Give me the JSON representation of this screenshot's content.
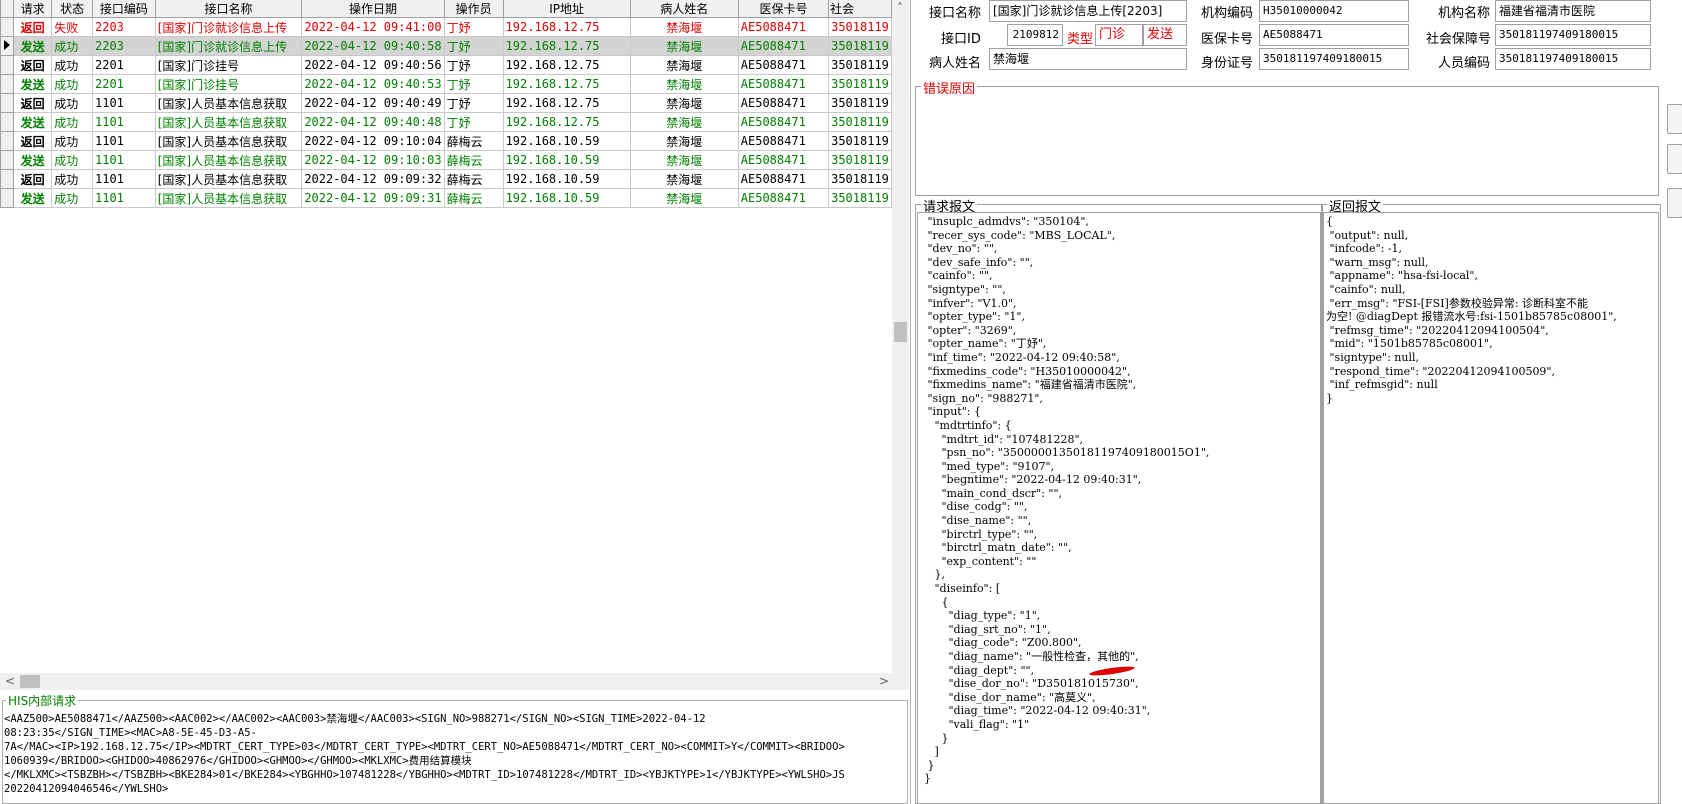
{
  "grid": {
    "headers": [
      "请求",
      "状态",
      "接口编码",
      "接口名称",
      "操作日期",
      "操作员",
      "IP地址",
      "病人姓名",
      "医保卡号",
      "社会"
    ],
    "rows": [
      {
        "kind": "返回",
        "status": "失败",
        "code": "2203",
        "name": "[国家]门诊就诊信息上传",
        "date": "2022-04-12 09:41:00",
        "operator": "丁妤",
        "ip": "192.168.12.75",
        "patient": "禁海堰",
        "card": "AE5088471",
        "social": "35018119",
        "color": "red",
        "selected": false
      },
      {
        "kind": "发送",
        "status": "成功",
        "code": "2203",
        "name": "[国家]门诊就诊信息上传",
        "date": "2022-04-12 09:40:58",
        "operator": "丁妤",
        "ip": "192.168.12.75",
        "patient": "禁海堰",
        "card": "AE5088471",
        "social": "35018119",
        "color": "green",
        "selected": true
      },
      {
        "kind": "返回",
        "status": "成功",
        "code": "2201",
        "name": "[国家]门诊挂号",
        "date": "2022-04-12 09:40:56",
        "operator": "丁妤",
        "ip": "192.168.12.75",
        "patient": "禁海堰",
        "card": "AE5088471",
        "social": "35018119",
        "color": "black",
        "selected": false
      },
      {
        "kind": "发送",
        "status": "成功",
        "code": "2201",
        "name": "[国家]门诊挂号",
        "date": "2022-04-12 09:40:53",
        "operator": "丁妤",
        "ip": "192.168.12.75",
        "patient": "禁海堰",
        "card": "AE5088471",
        "social": "35018119",
        "color": "green",
        "selected": false
      },
      {
        "kind": "返回",
        "status": "成功",
        "code": "1101",
        "name": "[国家]人员基本信息获取",
        "date": "2022-04-12 09:40:49",
        "operator": "丁妤",
        "ip": "192.168.12.75",
        "patient": "禁海堰",
        "card": "AE5088471",
        "social": "35018119",
        "color": "black",
        "selected": false
      },
      {
        "kind": "发送",
        "status": "成功",
        "code": "1101",
        "name": "[国家]人员基本信息获取",
        "date": "2022-04-12 09:40:48",
        "operator": "丁妤",
        "ip": "192.168.12.75",
        "patient": "禁海堰",
        "card": "AE5088471",
        "social": "35018119",
        "color": "green",
        "selected": false
      },
      {
        "kind": "返回",
        "status": "成功",
        "code": "1101",
        "name": "[国家]人员基本信息获取",
        "date": "2022-04-12 09:10:04",
        "operator": "薛梅云",
        "ip": "192.168.10.59",
        "patient": "禁海堰",
        "card": "AE5088471",
        "social": "35018119",
        "color": "black",
        "selected": false
      },
      {
        "kind": "发送",
        "status": "成功",
        "code": "1101",
        "name": "[国家]人员基本信息获取",
        "date": "2022-04-12 09:10:03",
        "operator": "薛梅云",
        "ip": "192.168.10.59",
        "patient": "禁海堰",
        "card": "AE5088471",
        "social": "35018119",
        "color": "green",
        "selected": false
      },
      {
        "kind": "返回",
        "status": "成功",
        "code": "1101",
        "name": "[国家]人员基本信息获取",
        "date": "2022-04-12 09:09:32",
        "operator": "薛梅云",
        "ip": "192.168.10.59",
        "patient": "禁海堰",
        "card": "AE5088471",
        "social": "35018119",
        "color": "black",
        "selected": false
      },
      {
        "kind": "发送",
        "status": "成功",
        "code": "1101",
        "name": "[国家]人员基本信息获取",
        "date": "2022-04-12 09:09:31",
        "operator": "薛梅云",
        "ip": "192.168.10.59",
        "patient": "禁海堰",
        "card": "AE5088471",
        "social": "35018119",
        "color": "green",
        "selected": false
      }
    ]
  },
  "scroll": {
    "up": "˄",
    "down": "˅",
    "left": "<",
    "right": ">"
  },
  "his": {
    "title": "HIS内部请求",
    "text": "<AAZ500>AE5088471</AAZ500><AAC002></AAC002><AAC003>禁海堰</AAC003><SIGN_NO>988271</SIGN_NO><SIGN_TIME>2022-04-12\n08:23:35</SIGN_TIME><MAC>A8-5E-45-D3-A5-\n7A</MAC><IP>192.168.12.75</IP><MDTRT_CERT_TYPE>03</MDTRT_CERT_TYPE><MDTRT_CERT_NO>AE5088471</MDTRT_CERT_NO><COMMIT>Y</COMMIT><BRIDOO>\n1060939</BRIDOO><GHIDOO>40862976</GHIDOO><GHMOO></GHMOO><MKLXMC>费用结算模块\n</MKLXMC><TSBZBH></TSBZBH><BKE284>01</BKE284><YBGHHO>107481228</YBGHHO><MDTRT_ID>107481228</MDTRT_ID><YBJKTYPE>1</YBJKTYPE><YWLSHO>JS\n20220412094046546</YWLSHO>"
  },
  "info": {
    "interface_name_label": "接口名称",
    "interface_name": "[国家]门诊就诊信息上传[2203]",
    "org_code_label": "机构编码",
    "org_code": "H35010000042",
    "org_name_label": "机构名称",
    "org_name": "福建省福清市医院",
    "interface_id_label": "接口ID",
    "interface_id": "2109812",
    "type_label": "类型",
    "type_value": "门诊",
    "direction_value": "发送",
    "card_label": "医保卡号",
    "card": "AE5088471",
    "social_label": "社会保障号",
    "social": "350181197409180015",
    "patient_label": "病人姓名",
    "patient": "禁海堰",
    "idcard_label": "身份证号",
    "idcard": "350181197409180015",
    "staff_label": "人员编码",
    "staff": "350181197409180015"
  },
  "error": {
    "title": "错误原因",
    "text": ""
  },
  "request": {
    "title": "请求报文",
    "text": " \"insuplc_admdvs\": \"350104\",\n \"recer_sys_code\": \"MBS_LOCAL\",\n \"dev_no\": \"\",\n \"dev_safe_info\": \"\",\n \"cainfo\": \"\",\n \"signtype\": \"\",\n \"infver\": \"V1.0\",\n \"opter_type\": \"1\",\n \"opter\": \"3269\",\n \"opter_name\": \"丁妤\",\n \"inf_time\": \"2022-04-12 09:40:58\",\n \"fixmedins_code\": \"H35010000042\",\n \"fixmedins_name\": \"福建省福清市医院\",\n \"sign_no\": \"988271\",\n \"input\": {\n   \"mdtrtinfo\": {\n     \"mdtrt_id\": \"107481228\",\n     \"psn_no\": \"35000001350181197409180015O1\",\n     \"med_type\": \"9107\",\n     \"begntime\": \"2022-04-12 09:40:31\",\n     \"main_cond_dscr\": \"\",\n     \"dise_codg\": \"\",\n     \"dise_name\": \"\",\n     \"birctrl_type\": \"\",\n     \"birctrl_matn_date\": \"\",\n     \"exp_content\": \"\"\n   },\n   \"diseinfo\": [\n     {\n       \"diag_type\": \"1\",\n       \"diag_srt_no\": \"1\",\n       \"diag_code\": \"Z00.800\",\n       \"diag_name\": \"一般性检查，其他的\",\n       \"diag_dept\": \"\",\n       \"dise_dor_no\": \"D350181015730\",\n       \"dise_dor_name\": \"高莫义\",\n       \"diag_time\": \"2022-04-12 09:40:31\",\n       \"vali_flag\": \"1\"\n     }\n   ]\n }\n}"
  },
  "response": {
    "title": "返回报文",
    "text": "{\n \"output\": null,\n \"infcode\": -1,\n \"warn_msg\": null,\n \"appname\": \"hsa-fsi-local\",\n \"cainfo\": null,\n \"err_msg\": \"FSI-[FSI]参数校验异常: 诊断科室不能\n为空! @diagDept 报错流水号:fsi-1501b85785c08001\",\n \"refmsg_time\": \"20220412094100504\",\n \"mid\": \"1501b85785c08001\",\n \"signtype\": null,\n \"respond_time\": \"20220412094100509\",\n \"inf_refmsgid\": null\n}"
  },
  "colors": {
    "error_red": "#e00000",
    "send_green": "#008000",
    "annotation_red": "#e00000"
  }
}
